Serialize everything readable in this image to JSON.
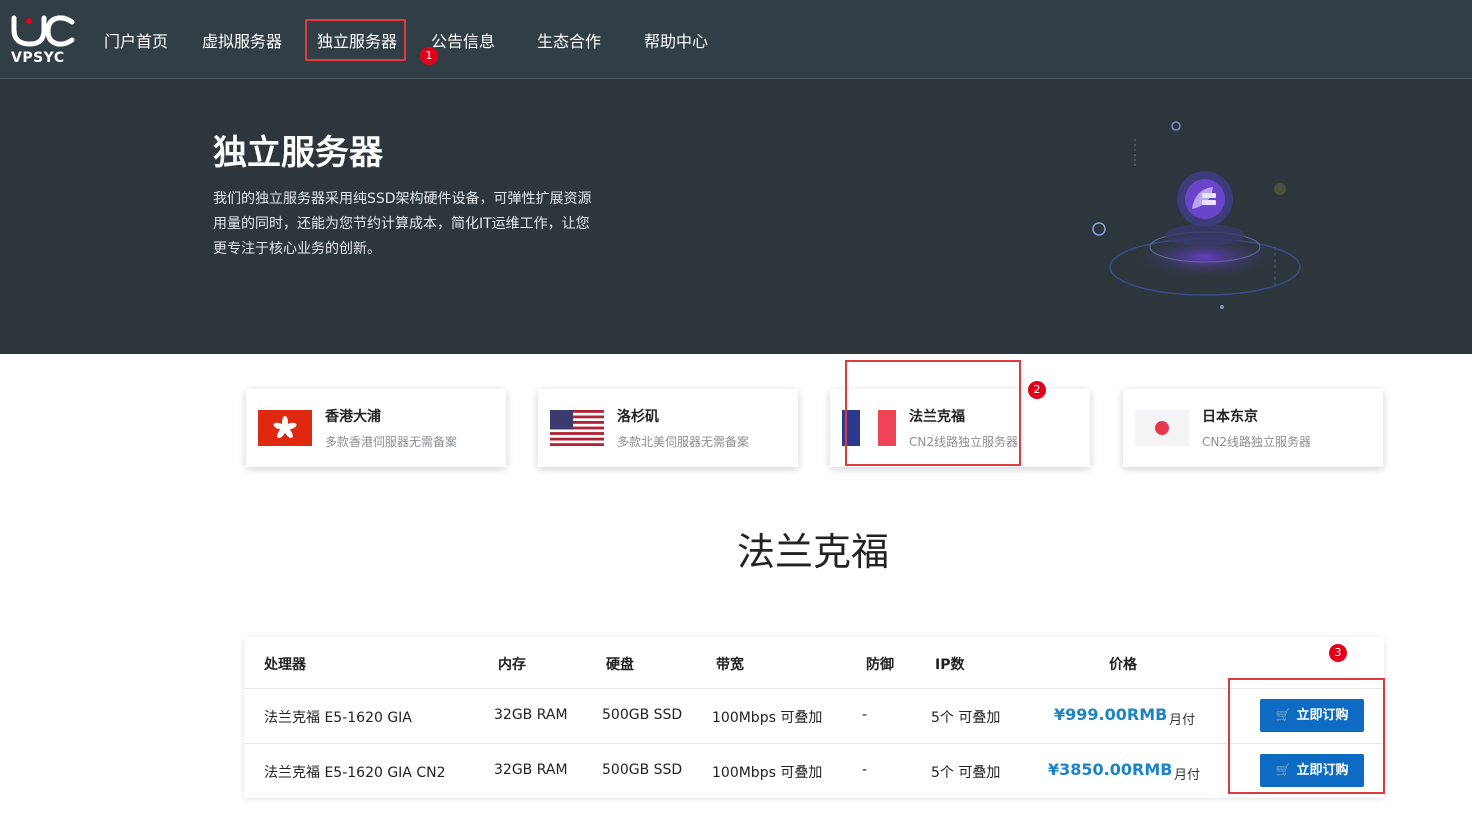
{
  "brand": {
    "logo_text": "VPSYC"
  },
  "nav": {
    "items": [
      "门户首页",
      "虚拟服务器",
      "独立服务器",
      "公告信息",
      "生态合作",
      "帮助中心"
    ],
    "active_index": 2
  },
  "markers": [
    "1",
    "2",
    "3"
  ],
  "hero": {
    "title": "独立服务器",
    "desc_lines": [
      "我们的独立服务器采用纯SSD架构硬件设备，可弹性扩展资源",
      "用量的同时，还能为您节约计算成本，简化IT运维工作，让您",
      "更专注于核心业务的创新。"
    ]
  },
  "locations": [
    {
      "title": "香港大浦",
      "sub": "多款香港伺服器无需备案",
      "flag": "hk-flag"
    },
    {
      "title": "洛杉矶",
      "sub": "多款北美伺服器无需备案",
      "flag": "us-flag"
    },
    {
      "title": "法兰克福",
      "sub": "CN2线路独立服务器",
      "flag": "fr-flag"
    },
    {
      "title": "日本东京",
      "sub": "CN2线路独立服务器",
      "flag": "jp-flag"
    }
  ],
  "section_title": "法兰克福",
  "table": {
    "headers": [
      "处理器",
      "内存",
      "硬盘",
      "带宽",
      "防御",
      "IP数",
      "价格"
    ],
    "rows": [
      {
        "cpu": "法兰克福 E5-1620 GIA",
        "ram": "32GB RAM",
        "disk": "500GB SSD",
        "bandwidth": "100Mbps 可叠加",
        "defense": "-",
        "ip": "5个 可叠加",
        "price": "¥999.00RMB",
        "period": "月付",
        "button": "立即订购"
      },
      {
        "cpu": "法兰克福 E5-1620 GIA CN2",
        "ram": "32GB RAM",
        "disk": "500GB SSD",
        "bandwidth": "100Mbps 可叠加",
        "defense": "-",
        "ip": "5个 可叠加",
        "price": "¥3850.00RMB",
        "period": "月付",
        "button": "立即订购"
      }
    ]
  },
  "colors": {
    "nav_bg": "#323e45",
    "hero_bg": "#2d363d",
    "accent_blue": "#1c84c6",
    "button_blue": "#0e6bc4",
    "highlight_red": "#e0393e"
  }
}
